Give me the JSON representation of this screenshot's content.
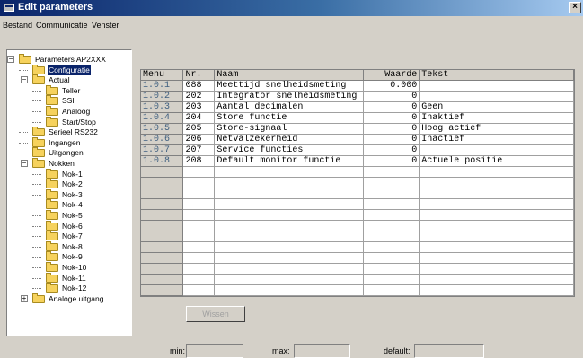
{
  "window": {
    "title": "Edit parameters",
    "close_label": "×"
  },
  "menu": [
    {
      "label": "Bestand"
    },
    {
      "label": "Communicatie"
    },
    {
      "label": "Venster"
    }
  ],
  "tree": [
    {
      "label": "Parameters AP2XXX",
      "expander": "−"
    },
    {
      "label": "Configuratie",
      "selected": true
    },
    {
      "label": "Actual",
      "expander": "−"
    },
    {
      "label": "Teller"
    },
    {
      "label": "SSI"
    },
    {
      "label": "Analoog"
    },
    {
      "label": "Start/Stop"
    },
    {
      "label": "Serieel RS232"
    },
    {
      "label": "Ingangen"
    },
    {
      "label": "Uitgangen"
    },
    {
      "label": "Nokken",
      "expander": "−"
    },
    {
      "label": "Nok-1"
    },
    {
      "label": "Nok-2"
    },
    {
      "label": "Nok-3"
    },
    {
      "label": "Nok-4"
    },
    {
      "label": "Nok-5"
    },
    {
      "label": "Nok-6"
    },
    {
      "label": "Nok-7"
    },
    {
      "label": "Nok-8"
    },
    {
      "label": "Nok-9"
    },
    {
      "label": "Nok-10"
    },
    {
      "label": "Nok-11"
    },
    {
      "label": "Nok-12"
    },
    {
      "label": "Analoge uitgang",
      "expander": "+"
    }
  ],
  "grid": {
    "columns": [
      "Menu",
      "Nr.",
      "Naam",
      "Waarde",
      "Tekst"
    ],
    "rows": [
      {
        "menu": "1.0.1",
        "nr": "088",
        "naam": "Meettijd snelheidsmeting",
        "waarde": "0.000",
        "tekst": ""
      },
      {
        "menu": "1.0.2",
        "nr": "202",
        "naam": "Integrator snelheidsmeting",
        "waarde": "0",
        "tekst": ""
      },
      {
        "menu": "1.0.3",
        "nr": "203",
        "naam": "Aantal decimalen",
        "waarde": "0",
        "tekst": "Geen"
      },
      {
        "menu": "1.0.4",
        "nr": "204",
        "naam": "Store functie",
        "waarde": "0",
        "tekst": "Inaktief"
      },
      {
        "menu": "1.0.5",
        "nr": "205",
        "naam": "Store-signaal",
        "waarde": "0",
        "tekst": "Hoog actief"
      },
      {
        "menu": "1.0.6",
        "nr": "206",
        "naam": "Netvalzekerheid",
        "waarde": "0",
        "tekst": "Inactief"
      },
      {
        "menu": "1.0.7",
        "nr": "207",
        "naam": "Service functies",
        "waarde": "0",
        "tekst": ""
      },
      {
        "menu": "1.0.8",
        "nr": "208",
        "naam": "Default monitor functie",
        "waarde": "0",
        "tekst": "Actuele positie"
      }
    ]
  },
  "actions": {
    "wissen_label": "Wissen"
  },
  "footer": {
    "min_label": "min:",
    "max_label": "max:",
    "default_label": "default:",
    "min_value": "",
    "max_value": "",
    "default_value": ""
  }
}
